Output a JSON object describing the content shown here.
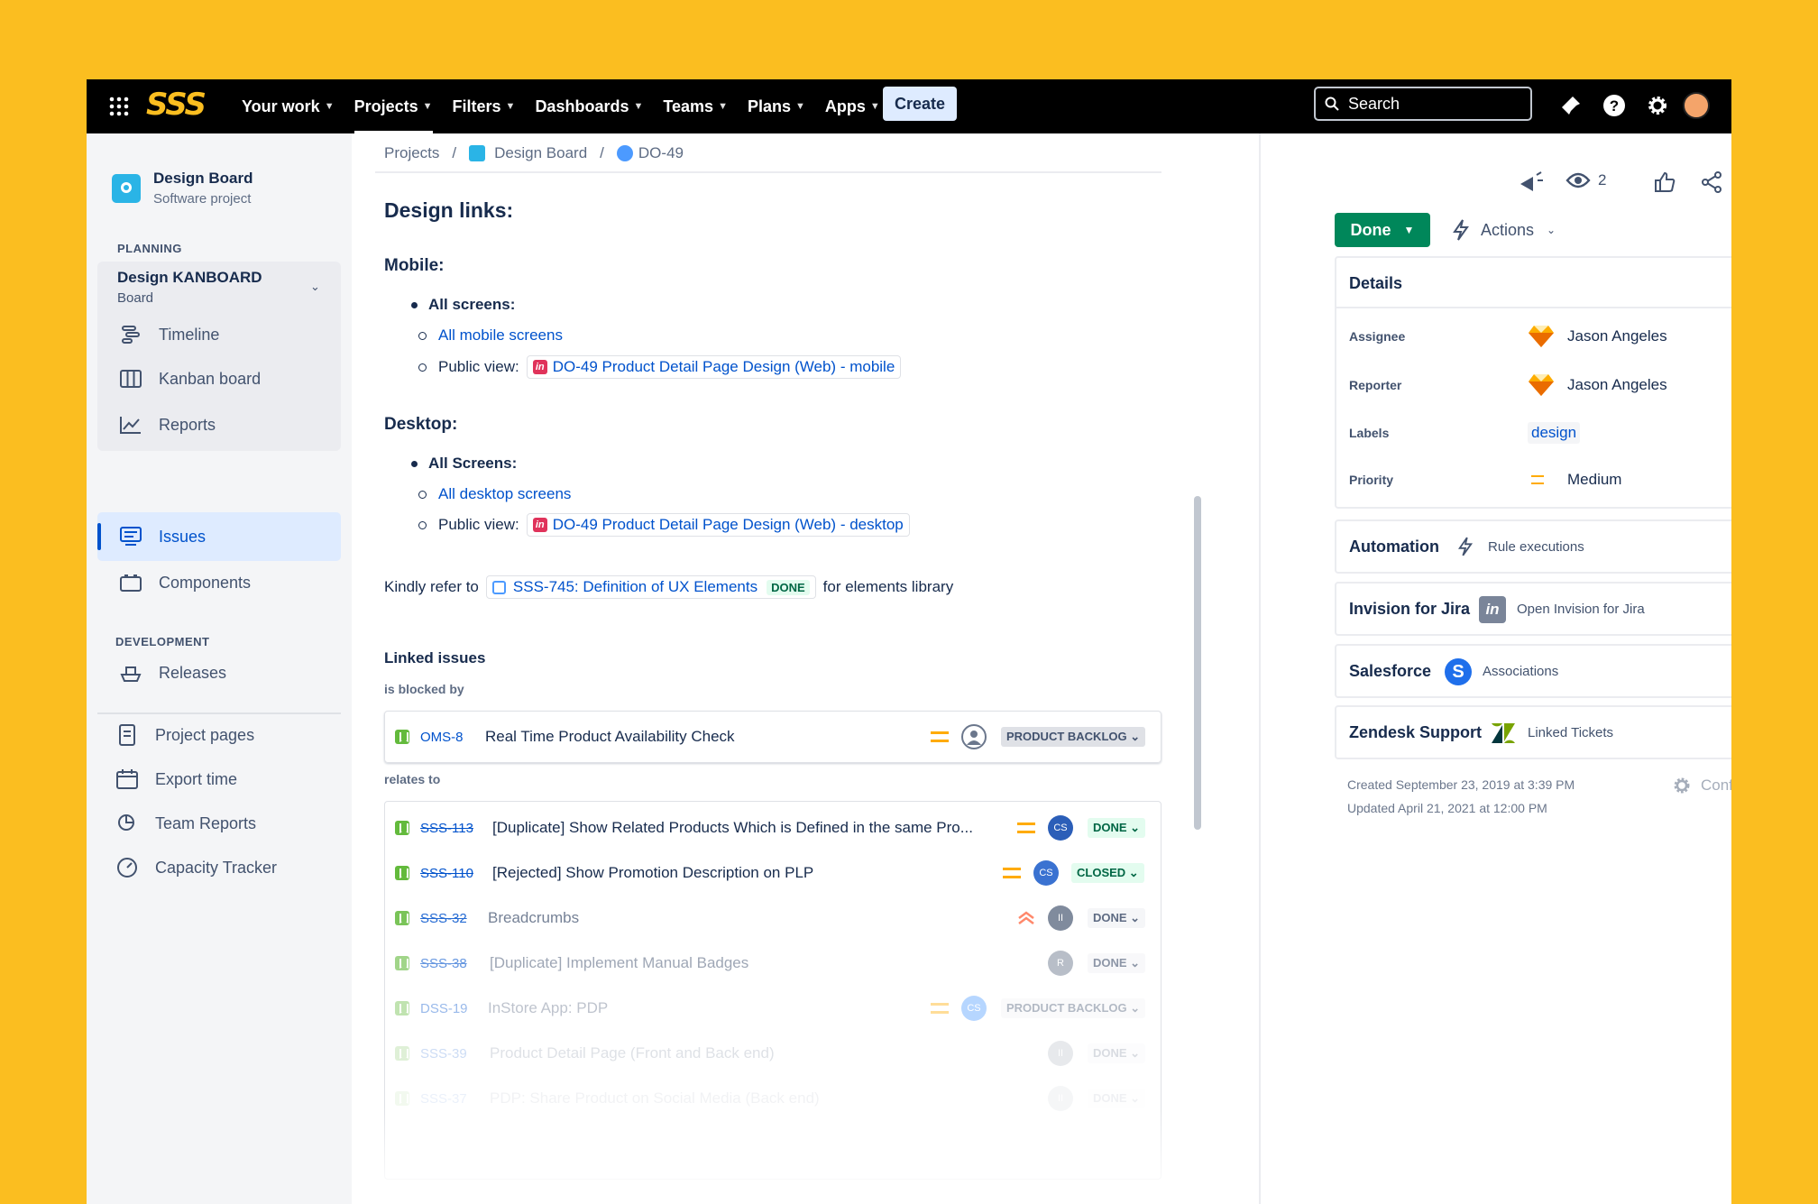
{
  "nav": {
    "logo": "SSS",
    "items": [
      {
        "label": "Your work"
      },
      {
        "label": "Projects"
      },
      {
        "label": "Filters"
      },
      {
        "label": "Dashboards"
      },
      {
        "label": "Teams"
      },
      {
        "label": "Plans"
      },
      {
        "label": "Apps"
      }
    ],
    "create": "Create",
    "search_label": "Search"
  },
  "sidebar": {
    "project_name": "Design Board",
    "project_type": "Software project",
    "planning_head": "PLANNING",
    "board_name": "Design KANBOARD",
    "board_type": "Board",
    "planning_items": [
      "Timeline",
      "Kanban board",
      "Reports"
    ],
    "issues": "Issues",
    "components": "Components",
    "development_head": "DEVELOPMENT",
    "releases": "Releases",
    "extra_items": [
      "Project pages",
      "Export time",
      "Team Reports",
      "Capacity Tracker"
    ]
  },
  "breadcrumb": {
    "projects": "Projects",
    "project": "Design Board",
    "issue": "DO-49",
    "sep": "/"
  },
  "content": {
    "heading": "Design links:",
    "mobile": {
      "title": "Mobile:",
      "bullet": "All screens:",
      "link1": "All mobile screens",
      "public_label": "Public view:",
      "public_link": "DO-49 Product Detail Page Design (Web) - mobile"
    },
    "desktop": {
      "title": "Desktop:",
      "bullet": "All Screens:",
      "link1": "All desktop screens",
      "public_label": "Public view:",
      "public_link": "DO-49 Product Detail Page Design (Web) - desktop"
    },
    "refer": {
      "prefix": "Kindly refer to",
      "link": "SSS-745: Definition of UX Elements",
      "status": "DONE",
      "suffix": "for elements library"
    }
  },
  "linked": {
    "title": "Linked issues",
    "blocked_by": "is blocked by",
    "relates_to": "relates to",
    "blocked": {
      "key": "OMS-8",
      "summary": "Real Time Product Availability Check",
      "status": "PRODUCT BACKLOG"
    },
    "related": [
      {
        "key": "SSS-113",
        "summary": "[Duplicate] Show Related Products Which is Defined in the same Pro...",
        "avatar": "CS",
        "status": "DONE"
      },
      {
        "key": "SSS-110",
        "summary": "[Rejected] Show Promotion Description on PLP",
        "avatar": "CS",
        "status": "CLOSED"
      },
      {
        "key": "SSS-32",
        "summary": "Breadcrumbs",
        "avatar": "II",
        "status": "DONE"
      },
      {
        "key": "SSS-38",
        "summary": "[Duplicate] Implement Manual Badges",
        "avatar": "R",
        "status": "DONE"
      },
      {
        "key": "DSS-19",
        "summary": "InStore App: PDP",
        "avatar": "CS",
        "status": "PRODUCT BACKLOG"
      },
      {
        "key": "SSS-39",
        "summary": "Product Detail Page (Front and Back end)",
        "avatar": "II",
        "status": "DONE"
      },
      {
        "key": "SSS-37",
        "summary": "PDP: Share Product on Social Media (Back end)",
        "avatar": "II",
        "status": "DONE"
      }
    ]
  },
  "right": {
    "watchers": "2",
    "status_btn": "Done",
    "actions": "Actions",
    "details": {
      "title": "Details",
      "assignee_label": "Assignee",
      "assignee": "Jason Angeles",
      "reporter_label": "Reporter",
      "reporter": "Jason Angeles",
      "labels_label": "Labels",
      "label": "design",
      "priority_label": "Priority",
      "priority": "Medium"
    },
    "automation": {
      "title": "Automation",
      "sub": "Rule executions"
    },
    "invision": {
      "title": "Invision for Jira",
      "sub": "Open Invision for Jira"
    },
    "salesforce": {
      "title": "Salesforce",
      "sub": "Associations"
    },
    "zendesk": {
      "title": "Zendesk Support",
      "sub": "Linked Tickets"
    },
    "created": "Created September 23, 2019 at 3:39 PM",
    "updated": "Updated April 21, 2021 at 12:00 PM",
    "configure": "Configure"
  },
  "colors": {
    "background": "#FBBE20",
    "nav": "#000000",
    "primary": "#0052CC",
    "done": "#00875A"
  }
}
